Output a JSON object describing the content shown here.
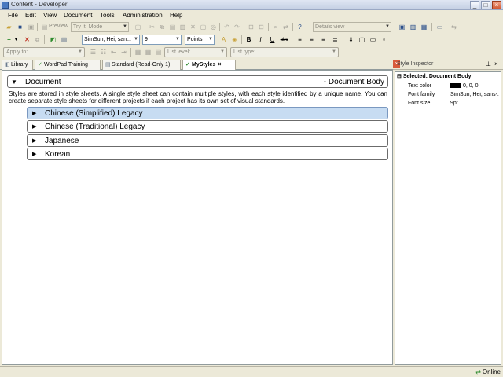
{
  "window": {
    "title": "Content - Developer",
    "controls": {
      "minimize": "_",
      "maximize": "□",
      "close": "×"
    }
  },
  "menu": [
    "File",
    "Edit",
    "View",
    "Document",
    "Tools",
    "Administration",
    "Help"
  ],
  "toolbar1": {
    "preview_label": "Preview",
    "mode_value": "Try It! Mode",
    "view_value": "Details view"
  },
  "toolbar2": {
    "font_value": "SimSun, Hei, san...",
    "size_value": "9",
    "unit_value": "Points",
    "bold": "B",
    "italic": "I",
    "underline": "U",
    "strike": "abc"
  },
  "toolbar3": {
    "apply_to_label": "Apply to:",
    "list_level_label": "List level:",
    "list_type_label": "List type:"
  },
  "tabs": [
    {
      "label": "Library",
      "icon": "book-icon"
    },
    {
      "label": "WordPad Training",
      "icon": "check-icon"
    },
    {
      "label": "Standard (Read-Only 1)",
      "icon": "doc-icon"
    },
    {
      "label": "MyStyles",
      "icon": "check-icon",
      "active": true,
      "close": "×"
    }
  ],
  "editor": {
    "root_label": "Document",
    "root_right": "- Document Body",
    "description": "Styles are stored in style sheets. A single style sheet can contain multiple styles, with each style identified by a unique name. You can create separate style sheets for different projects if each project has its own set of visual standards.",
    "styles": [
      {
        "label": "Chinese (Simplified) Legacy",
        "selected": true
      },
      {
        "label": "Chinese (Traditional) Legacy",
        "selected": false
      },
      {
        "label": "Japanese",
        "selected": false
      },
      {
        "label": "Korean",
        "selected": false
      }
    ]
  },
  "inspector": {
    "title": "Style Inspector",
    "selected_label": "Selected: Document Body",
    "properties": [
      {
        "key": "Text color",
        "value": "0, 0, 0",
        "swatch": "#000000"
      },
      {
        "key": "Font family",
        "value": "SimSun, Hei, sans-..."
      },
      {
        "key": "Font size",
        "value": "9pt"
      }
    ]
  },
  "status": {
    "text": "Online"
  },
  "colors": {
    "selected_row": "#c7dcf2",
    "chrome": "#ece9d8"
  }
}
